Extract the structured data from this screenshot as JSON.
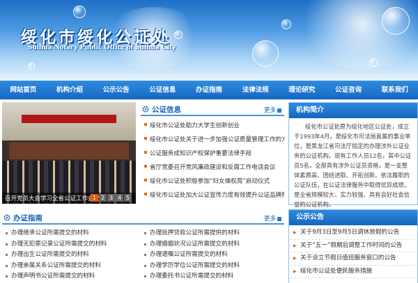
{
  "header": {
    "title": "绥化市绥化公证处",
    "subtitle": "Suihua Notary Public Office of Suihua City"
  },
  "nav": [
    {
      "label": "网站首页"
    },
    {
      "label": "机构介绍"
    },
    {
      "label": "公示公告"
    },
    {
      "label": "公证信息"
    },
    {
      "label": "办证指南"
    },
    {
      "label": "法律法规"
    },
    {
      "label": "理论研究"
    },
    {
      "label": "公证咨询"
    },
    {
      "label": "联系我们"
    }
  ],
  "slideshow": {
    "caption": "召开党员大会学习全省公证工作会议",
    "pages": [
      "1",
      "2",
      "3",
      "4",
      "5"
    ],
    "active_page": "1"
  },
  "news": {
    "title": "公证信息",
    "more": "更多",
    "items": [
      "绥化市公证处助力大学生创新创业",
      "绥化市公证处关于进一步加强公证质量管理工作的方案",
      "公证服务成知识产权保护重要法律手段",
      "省厅党委召开党风廉政建设和反腐工作电话会议",
      "绥化市公证处积极参加“妇女维权周”启动仪式",
      "绥化市公证处加大公证宣传力度有效提升公证品牌形象"
    ]
  },
  "guide": {
    "title": "办证指南",
    "more": "更多",
    "left": [
      "办理继承公证所需提交的材料",
      "办理无犯罪记录公证所需提交的材料",
      "办理出生公证所需提交的材料",
      "办理亲属关系公证所需提交的材料",
      "办理声明书公证所需提交的材料"
    ],
    "right": [
      "办理抵押贷款公证所需提供的材料",
      "办理婚姻状况公证所需提交的材料",
      "办理遗嘱公证所需提交的材料",
      "办理学历学位公证所需提交的材料",
      "办理委托书公证所需提交的材料"
    ]
  },
  "intro": {
    "title": "机构简介",
    "text": "绥化市公证处原为绥化地区公证处，成立于1993年4月，是绥化市司法局直属的事业单位，是黑龙江省司法厅指定的办理涉外公证业务的公证机构。现有工作人员12名，其中公证员5名，全部具有涉外公证员资格，是一支整体素质高、团结进取、开拓创新、依法履职的公证队伍，在公证法律服务中取得优异成绩，是全省规模较大、实力较强、具有良好社会信誉的公证机构。"
  },
  "notice": {
    "title": "公示公告",
    "items": [
      "关于9月3日至9月5日调休放假的公告",
      "关于“五一”假期后调整工作时间的公告",
      "关于设立节假日值班服务窗口的公告",
      "绥化市公证处便民服务措施"
    ]
  },
  "colors": {
    "accent": "#1b63b8",
    "nav": "#1668c2",
    "bullet": "#e06b1a"
  }
}
